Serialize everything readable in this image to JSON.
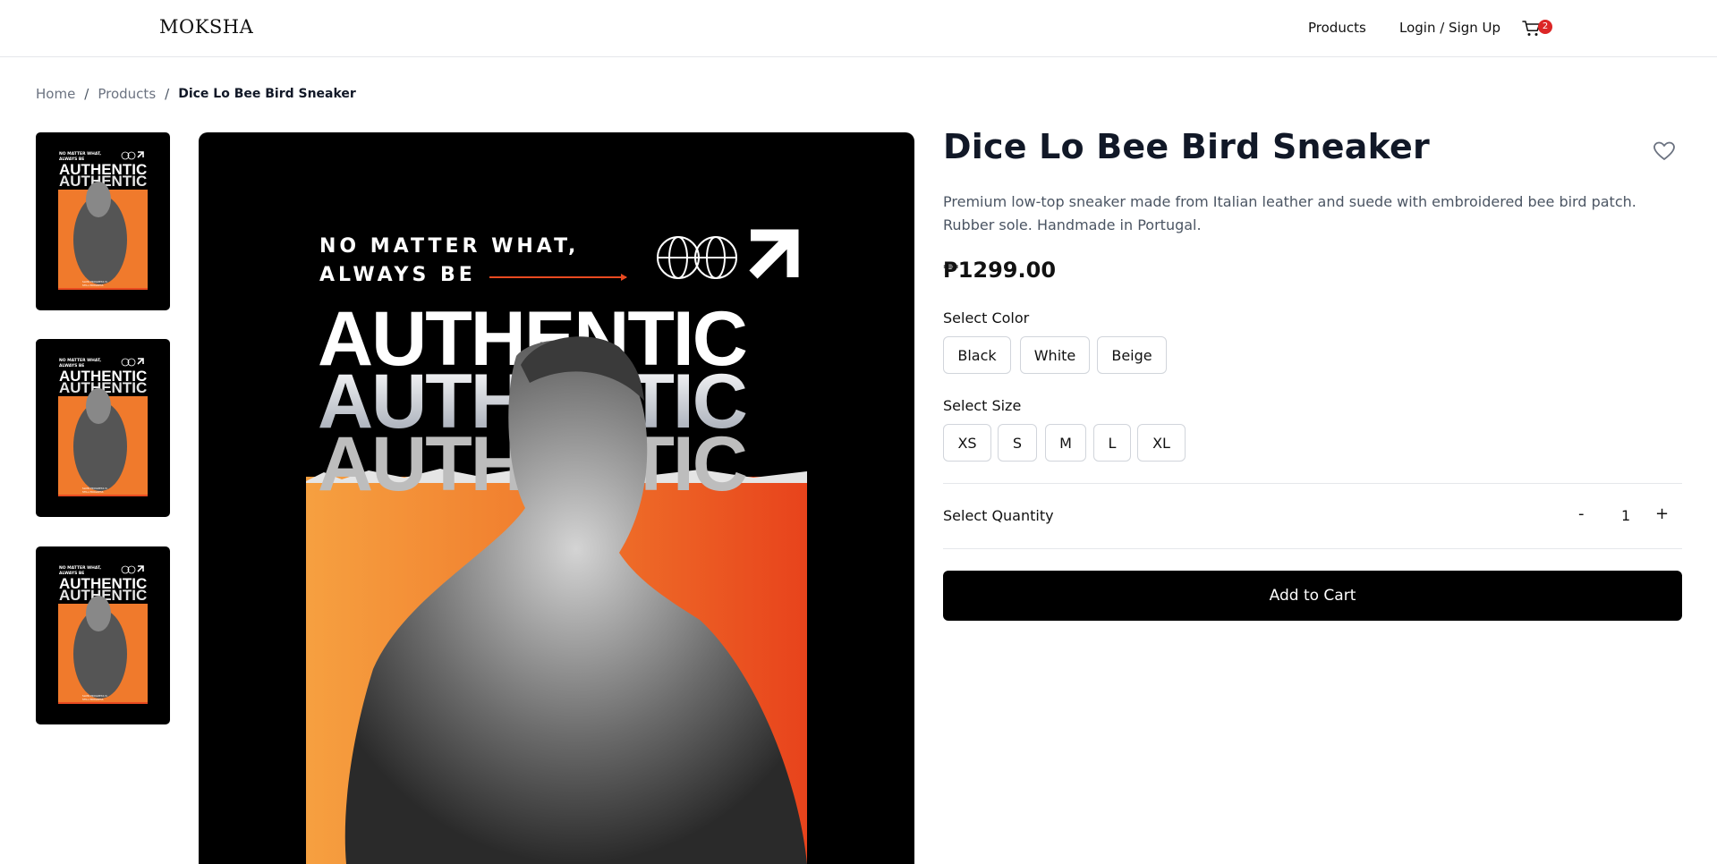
{
  "header": {
    "logo": "MOKSHA",
    "nav": {
      "products": "Products",
      "login": "Login / Sign Up"
    },
    "cart_count": "2"
  },
  "breadcrumb": {
    "home": "Home",
    "products": "Products",
    "current": "Dice Lo Bee Bird Sneaker"
  },
  "gallery": {
    "poster": {
      "line1": "NO MATTER WHAT,",
      "line2": "ALWAYS BE",
      "word": "AUTHENTIC",
      "footer1": "SLOW PROGRESS IS",
      "footer2": "STILL PROGRESS"
    }
  },
  "product": {
    "title": "Dice Lo Bee Bird Sneaker",
    "description": "Premium low-top sneaker made from Italian leather and suede with embroidered bee bird patch. Rubber sole. Handmade in Portugal.",
    "price": "₱1299.00",
    "color_label": "Select Color",
    "colors": [
      "Black",
      "White",
      "Beige"
    ],
    "size_label": "Select Size",
    "sizes": [
      "XS",
      "S",
      "M",
      "L",
      "XL"
    ],
    "quantity_label": "Select Quantity",
    "quantity": "1",
    "qty_minus": "-",
    "qty_plus": "+",
    "add_to_cart": "Add to Cart"
  },
  "colors": {
    "accent": "#000000",
    "badge": "#dc2626",
    "poster_orange": "#f07a2c"
  }
}
